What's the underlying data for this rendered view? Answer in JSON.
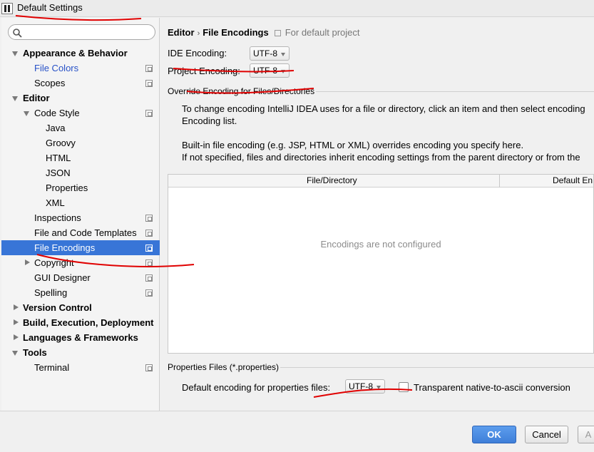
{
  "window": {
    "title": "Default Settings"
  },
  "search": {
    "placeholder": ""
  },
  "sidebar": {
    "items": [
      {
        "label": "Appearance & Behavior",
        "style": "bold",
        "expander": "down"
      },
      {
        "label": "File Colors",
        "style": "blue",
        "project_icon": true
      },
      {
        "label": "Scopes",
        "style": "normal",
        "project_icon": true
      },
      {
        "label": "Editor",
        "style": "bold",
        "expander": "down"
      },
      {
        "label": "Code Style",
        "style": "normal",
        "expander": "down",
        "project_icon": true
      },
      {
        "label": "Java",
        "style": "normal"
      },
      {
        "label": "Groovy",
        "style": "normal"
      },
      {
        "label": "HTML",
        "style": "normal"
      },
      {
        "label": "JSON",
        "style": "normal"
      },
      {
        "label": "Properties",
        "style": "normal"
      },
      {
        "label": "XML",
        "style": "normal"
      },
      {
        "label": "Inspections",
        "style": "normal",
        "project_icon": true
      },
      {
        "label": "File and Code Templates",
        "style": "normal",
        "project_icon": true
      },
      {
        "label": "File Encodings",
        "style": "normal",
        "selected": true,
        "project_icon": true
      },
      {
        "label": "Copyright",
        "style": "normal",
        "expander": "right",
        "project_icon": true
      },
      {
        "label": "GUI Designer",
        "style": "normal",
        "project_icon": true
      },
      {
        "label": "Spelling",
        "style": "normal",
        "project_icon": true
      },
      {
        "label": "Version Control",
        "style": "bold",
        "expander": "right"
      },
      {
        "label": "Build, Execution, Deployment",
        "style": "bold",
        "expander": "right"
      },
      {
        "label": "Languages & Frameworks",
        "style": "bold",
        "expander": "right"
      },
      {
        "label": "Tools",
        "style": "bold",
        "expander": "down"
      },
      {
        "label": "Terminal",
        "style": "normal",
        "project_icon": true
      }
    ]
  },
  "main": {
    "breadcrumb": {
      "parent": "Editor",
      "separator": "›",
      "current": "File Encodings",
      "note": "For default project"
    },
    "ide_encoding": {
      "label": "IDE Encoding:",
      "value": "UTF-8"
    },
    "project_encoding": {
      "label": "Project Encoding:",
      "value": "UTF-8"
    },
    "override_section": {
      "title": "Override Encoding for Files/Directories"
    },
    "paragraphs": [
      "To change encoding IntelliJ IDEA uses for a file or directory, click an item and then select encoding",
      "Encoding list.",
      "Built-in file encoding (e.g. JSP, HTML or XML) overrides encoding you specify here.",
      "If not specified, files and directories inherit encoding settings from the parent directory or from the"
    ],
    "table": {
      "columns": [
        "File/Directory",
        "Default En"
      ],
      "empty_text": "Encodings are not configured"
    },
    "properties_section": {
      "title": "Properties Files (*.properties)",
      "default_label": "Default encoding for properties files:",
      "default_value": "UTF-8",
      "transparent_label": "Transparent native-to-ascii conversion",
      "transparent_checked": false
    }
  },
  "footer": {
    "ok": "OK",
    "cancel": "Cancel",
    "apply": "A"
  },
  "colors": {
    "selection": "#3875d7",
    "annotation": "#e00000",
    "link": "#2751c7"
  }
}
